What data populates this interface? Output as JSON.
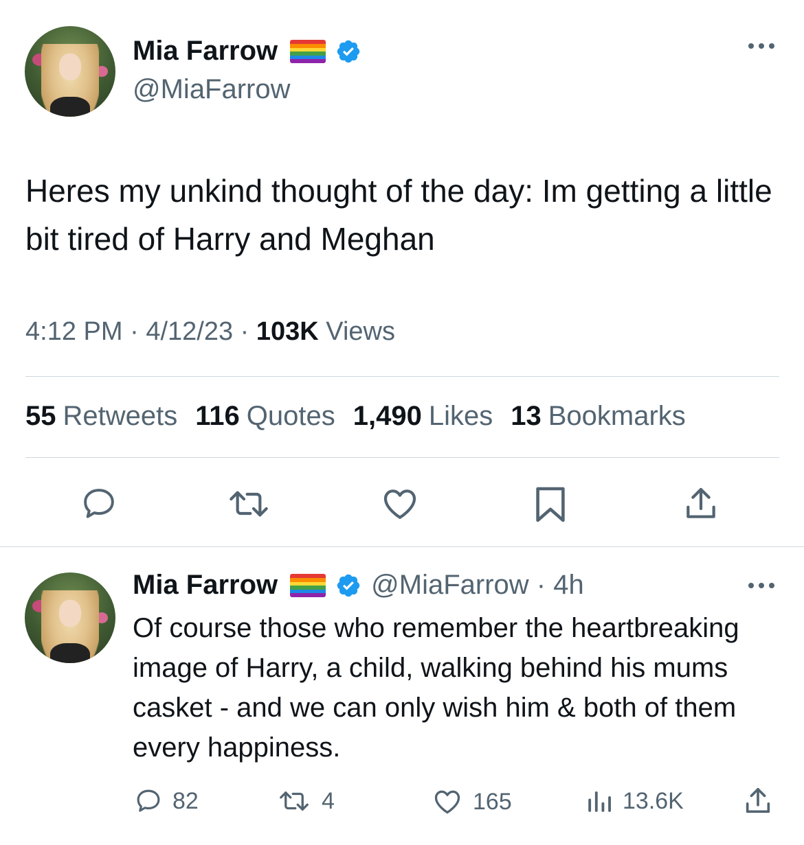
{
  "main_tweet": {
    "author_name": "Mia Farrow",
    "handle": "@MiaFarrow",
    "more_label": "•••",
    "text": "Heres my unkind thought of the day: Im getting a little bit tired of Harry and Meghan",
    "time": "4:12 PM",
    "sep": "·",
    "date": "4/12/23",
    "views_count": "103K",
    "views_label": "Views",
    "stats": [
      {
        "count": "55",
        "label": "Retweets"
      },
      {
        "count": "116",
        "label": "Quotes"
      },
      {
        "count": "1,490",
        "label": "Likes"
      },
      {
        "count": "13",
        "label": "Bookmarks"
      }
    ]
  },
  "reply_tweet": {
    "author_name": "Mia Farrow",
    "handle_time": "@MiaFarrow · 4h",
    "more_label": "•••",
    "text": "Of course those who remember the heartbreaking image of Harry, a child, walking behind his mums casket - and we can only wish him &  both of them every happiness.",
    "replies": "82",
    "retweets": "4",
    "likes": "165",
    "views": "13.6K"
  },
  "colors": {
    "text_primary": "#0f1419",
    "text_secondary": "#536471",
    "verified_blue": "#1d9bf0",
    "divider": "#cfd9de"
  },
  "icons": [
    "reply-icon",
    "retweet-icon",
    "like-icon",
    "bookmark-icon",
    "share-icon",
    "views-icon",
    "verified-badge-icon",
    "rainbow-flag-icon",
    "more-icon"
  ]
}
